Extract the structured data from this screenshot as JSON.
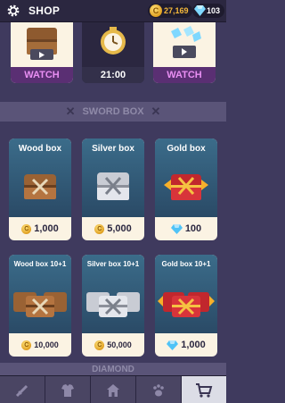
{
  "header": {
    "title": "SHOP",
    "coins": "27,169",
    "gems": "103"
  },
  "watch_cards": [
    {
      "label": "WATCH",
      "icon": "chest-video-icon"
    },
    {
      "label": "21:00",
      "icon": "timer-chest-icon"
    },
    {
      "label": "WATCH",
      "icon": "gem-video-icon"
    }
  ],
  "sections": {
    "sword_box": "SWORD BOX",
    "diamond": "DIAMOND"
  },
  "boxes": [
    {
      "name": "Wood box",
      "price": "1,000",
      "currency": "coin"
    },
    {
      "name": "Silver box",
      "price": "5,000",
      "currency": "coin"
    },
    {
      "name": "Gold box",
      "price": "100",
      "currency": "gem"
    },
    {
      "name": "Wood box 10+1",
      "price": "10,000",
      "currency": "coin"
    },
    {
      "name": "Silver box 10+1",
      "price": "50,000",
      "currency": "coin"
    },
    {
      "name": "Gold box 10+1",
      "price": "1,000",
      "currency": "gem"
    }
  ],
  "nav": [
    "sword-icon",
    "armor-icon",
    "home-icon",
    "paw-icon",
    "cart-icon"
  ],
  "colors": {
    "background": "#3f3a5e",
    "card": "#fbf3e3",
    "watch_purple": "#e98ff3",
    "coin_gold": "#f6b93b"
  }
}
